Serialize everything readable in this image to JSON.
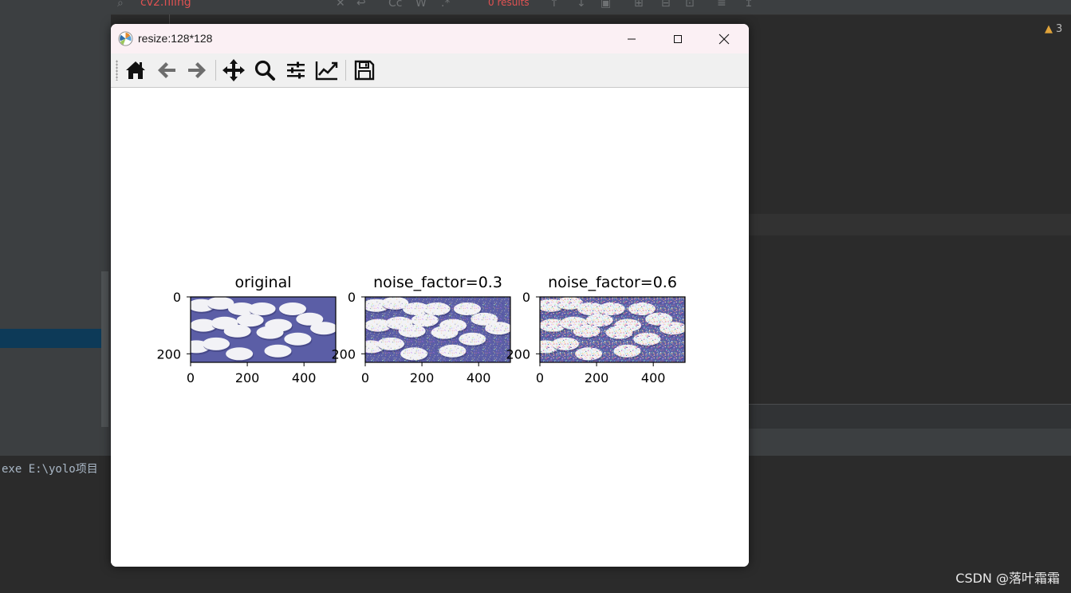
{
  "ide": {
    "find_query": "cv2.filing",
    "find_results": "0 results",
    "warning_count": "3",
    "console_text": "exe E:\\yolo项目",
    "watermark": "CSDN @落叶霜霜"
  },
  "window": {
    "title": "resize:128*128",
    "controls": [
      "minimize",
      "maximize",
      "close"
    ]
  },
  "toolbar": {
    "tools": [
      {
        "name": "home",
        "icon": "home-icon"
      },
      {
        "name": "back",
        "icon": "arrow-left-icon"
      },
      {
        "name": "forward",
        "icon": "arrow-right-icon"
      },
      {
        "name": "pan",
        "icon": "move-icon"
      },
      {
        "name": "zoom",
        "icon": "search-icon"
      },
      {
        "name": "configure subplots",
        "icon": "sliders-icon"
      },
      {
        "name": "edit axis",
        "icon": "chart-line-icon"
      },
      {
        "name": "save",
        "icon": "floppy-icon"
      }
    ]
  },
  "figure": {
    "subplots": [
      {
        "title": "original",
        "xticks": [
          "0",
          "200",
          "400"
        ],
        "yticks": [
          "0",
          "200"
        ],
        "noise": 0
      },
      {
        "title": "noise_factor=0.3",
        "xticks": [
          "0",
          "200",
          "400"
        ],
        "yticks": [
          "0",
          "200"
        ],
        "noise": 0.3
      },
      {
        "title": "noise_factor=0.6",
        "xticks": [
          "0",
          "200",
          "400"
        ],
        "yticks": [
          "0",
          "200"
        ],
        "noise": 0.6
      }
    ],
    "image_extent": {
      "x": [
        0,
        512
      ],
      "y": [
        230,
        0
      ]
    }
  },
  "colors": {
    "image_background": "#5b5ea6",
    "pill": "#f2f2f6",
    "ide_dark": "#2b2b2b",
    "ide_panel": "#3c3f41"
  }
}
